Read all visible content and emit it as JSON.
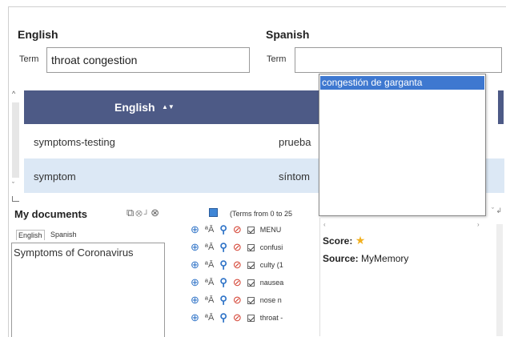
{
  "english": {
    "title": "English",
    "term_label": "Term",
    "term_value": "throat congestion"
  },
  "spanish": {
    "title": "Spanish",
    "term_label": "Term",
    "term_value": ""
  },
  "autocomplete": {
    "items": [
      "congestión de garganta"
    ]
  },
  "grid": {
    "header": "English",
    "sort_indicator": "▲▼",
    "rows": [
      {
        "english": "symptoms-testing",
        "spanish": "prueba"
      },
      {
        "english": "symptom",
        "spanish": "síntom"
      }
    ]
  },
  "my_documents": {
    "title": "My documents",
    "terms_range": "(Terms from 0 to 25",
    "tabs": [
      "English",
      "Spanish"
    ],
    "document": "Symptoms of Coronavirus",
    "rows": [
      "MENU",
      "confusi",
      "culty (1",
      "nausea",
      "nose n",
      "throat -"
    ]
  },
  "detail": {
    "score_label": "Score:",
    "source_label": "Source:",
    "source_value": "MyMemory"
  },
  "colors": {
    "header": "#4d5a86",
    "selection": "#3e78d0",
    "star": "#f2b01e"
  },
  "icons": [
    "add-icon",
    "language-icon",
    "search-icon",
    "block-icon",
    "star-icon"
  ]
}
